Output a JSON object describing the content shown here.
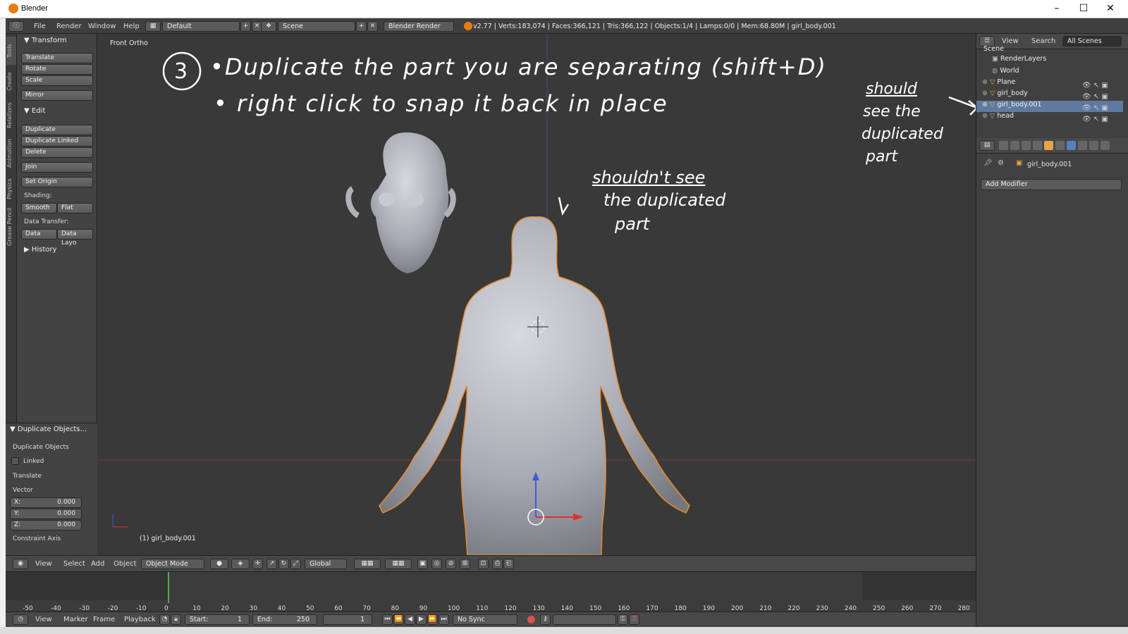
{
  "window": {
    "title": "Blender",
    "minimize": "–",
    "maximize": "☐",
    "close": "✕"
  },
  "menubar": {
    "items": [
      "File",
      "Render",
      "Window",
      "Help"
    ],
    "layout": "Default",
    "scene": "Scene",
    "engine": "Blender Render",
    "stats": "v2.77 | Verts:183,074 | Faces:366,121 | Tris:366,122 | Objects:1/4 | Lamps:0/0 | Mem:68.80M | girl_body.001"
  },
  "tool_tabs": [
    "Tools",
    "Create",
    "Relations",
    "Animation",
    "Physics",
    "Grease Pencil"
  ],
  "toolshelf": {
    "transform_header": "Transform",
    "transform_buttons": [
      "Translate",
      "Rotate",
      "Scale"
    ],
    "mirror": "Mirror",
    "edit_header": "Edit",
    "edit_buttons": [
      "Duplicate",
      "Duplicate Linked",
      "Delete"
    ],
    "join": "Join",
    "set_origin": "Set Origin",
    "shading_label": "Shading:",
    "smooth": "Smooth",
    "flat": "Flat",
    "data_transfer_label": "Data Transfer:",
    "data": "Data",
    "data_layout": "Data Layo",
    "history_header": "History"
  },
  "operator_panel": {
    "header": "Duplicate Objects...",
    "title": "Duplicate Objects",
    "linked": "Linked",
    "translate": "Translate",
    "vector": "Vector",
    "x_label": "X:",
    "x": "0.000",
    "y_label": "Y:",
    "y": "0.000",
    "z_label": "Z:",
    "z": "0.000",
    "constraint_axis": "Constraint Axis"
  },
  "viewport": {
    "view_name": "Front Ortho",
    "active_object": "(1) girl_body.001",
    "annotation_step": "3",
    "annotation_line1": "•Duplicate the part you are separating (shift+D)",
    "annotation_line2": "• right click to snap it back in place",
    "note_shouldnt_1": "shouldn't see",
    "note_shouldnt_2": "the duplicated",
    "note_shouldnt_3": "part",
    "note_should_1": "should",
    "note_should_2": "see the",
    "note_should_3": "duplicated",
    "note_should_4": "part"
  },
  "view3d_header": {
    "menus": [
      "View",
      "Select",
      "Add",
      "Object"
    ],
    "mode": "Object Mode",
    "orientation": "Global"
  },
  "timeline": {
    "ticks": [
      "-50",
      "-40",
      "-30",
      "-20",
      "-10",
      "0",
      "10",
      "20",
      "30",
      "40",
      "50",
      "60",
      "70",
      "80",
      "90",
      "100",
      "110",
      "120",
      "130",
      "140",
      "150",
      "160",
      "170",
      "180",
      "190",
      "200",
      "210",
      "220",
      "230",
      "240",
      "250",
      "260",
      "270",
      "280"
    ],
    "menus": [
      "View",
      "Marker",
      "Frame",
      "Playback"
    ],
    "start_label": "Start:",
    "start": "1",
    "end_label": "End:",
    "end": "250",
    "current": "1",
    "sync": "No Sync"
  },
  "outliner": {
    "view": "View",
    "search": "Search",
    "scenes": "All Scenes",
    "items": [
      {
        "name": "Scene"
      },
      {
        "name": "RenderLayers"
      },
      {
        "name": "World"
      },
      {
        "name": "Plane"
      },
      {
        "name": "girl_body"
      },
      {
        "name": "girl_body.001"
      },
      {
        "name": "head"
      }
    ]
  },
  "properties": {
    "object": "girl_body.001",
    "add_modifier": "Add Modifier"
  },
  "colors": {
    "accent_selection": "#607a9f",
    "orange": "#e87d0d",
    "viewport_bg": "#393939"
  }
}
